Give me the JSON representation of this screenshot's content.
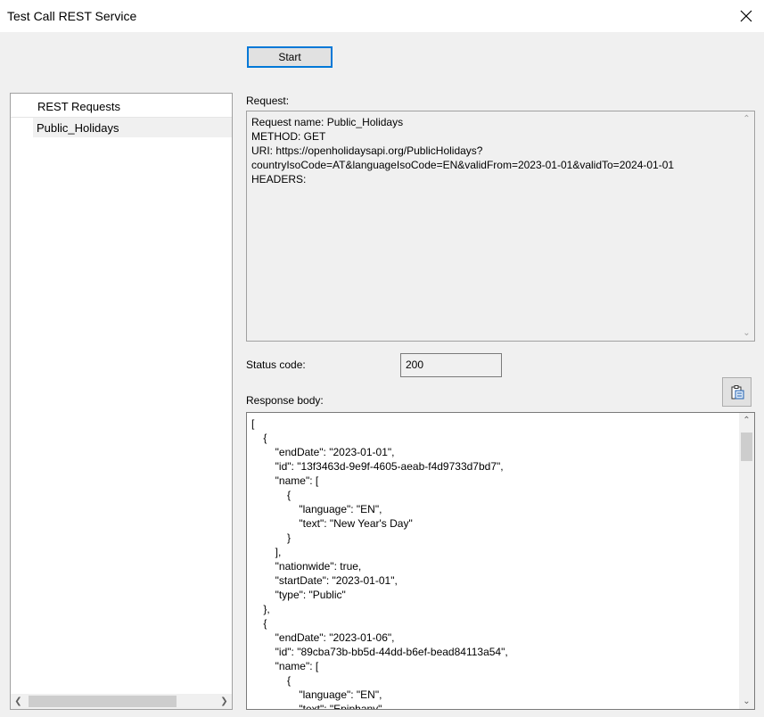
{
  "window": {
    "title": "Test Call REST Service"
  },
  "toolbar": {
    "start_label": "Start"
  },
  "requests_list": {
    "header": "REST Requests",
    "items": [
      {
        "label": "Public_Holidays"
      }
    ]
  },
  "request": {
    "label": "Request:",
    "text": "Request name: Public_Holidays\nMETHOD: GET\nURI: https://openholidaysapi.org/PublicHolidays?\ncountryIsoCode=AT&languageIsoCode=EN&validFrom=2023-01-01&validTo=2024-01-01\nHEADERS:"
  },
  "status": {
    "label": "Status code:",
    "value": "200"
  },
  "response": {
    "label": "Response body:",
    "body": "[\n    {\n        \"endDate\": \"2023-01-01\",\n        \"id\": \"13f3463d-9e9f-4605-aeab-f4d9733d7bd7\",\n        \"name\": [\n            {\n                \"language\": \"EN\",\n                \"text\": \"New Year's Day\"\n            }\n        ],\n        \"nationwide\": true,\n        \"startDate\": \"2023-01-01\",\n        \"type\": \"Public\"\n    },\n    {\n        \"endDate\": \"2023-01-06\",\n        \"id\": \"89cba73b-bb5d-44dd-b6ef-bead84113a54\",\n        \"name\": [\n            {\n                \"language\": \"EN\",\n                \"text\": \"Epiphany\""
  },
  "colors": {
    "accent": "#0078d7",
    "window_bg": "#f0f0f0",
    "field_border": "#7a7a7a"
  },
  "icons": {
    "close": "close-icon",
    "copy": "clipboard-icon"
  }
}
